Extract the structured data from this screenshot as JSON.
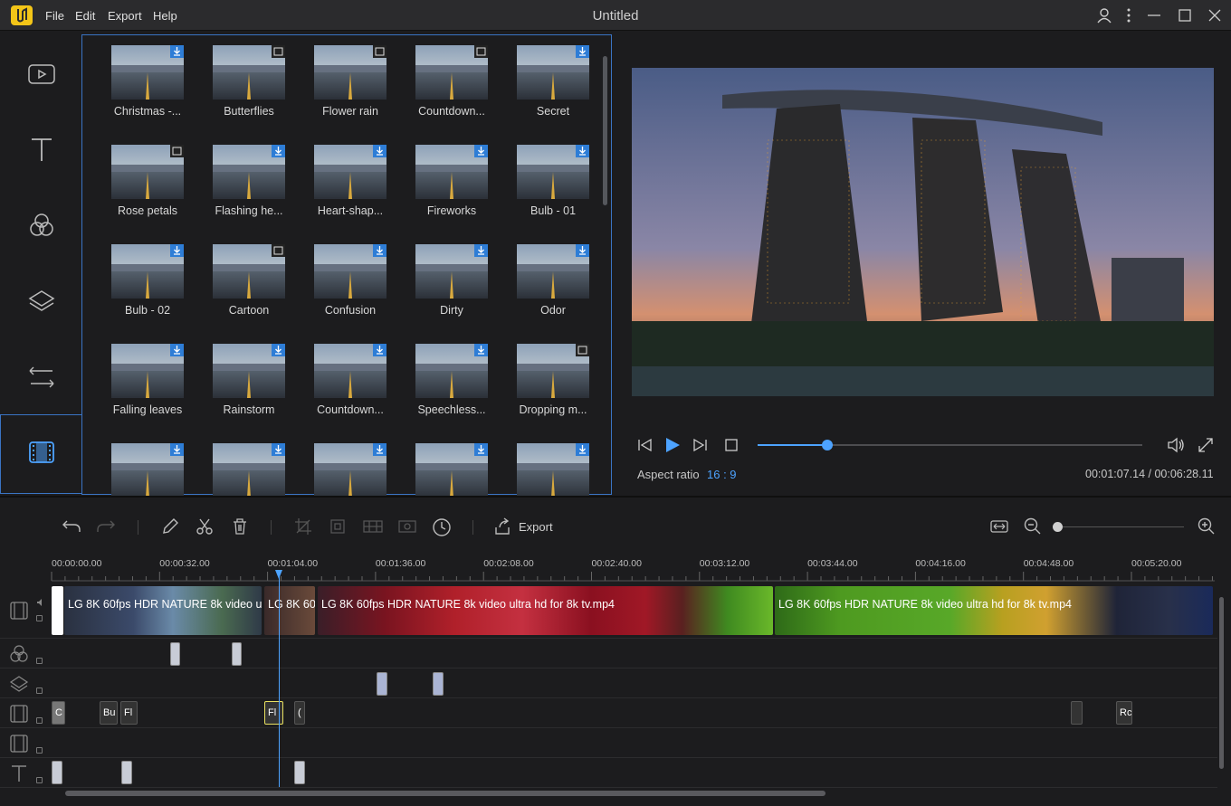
{
  "app": {
    "title": "Untitled",
    "menu": [
      "File",
      "Edit",
      "Export",
      "Help"
    ],
    "accent": "#3a74c4",
    "highlight": "#4da3ff"
  },
  "sidebar": {
    "items": [
      {
        "icon": "media-icon"
      },
      {
        "icon": "text-icon"
      },
      {
        "icon": "filters-icon"
      },
      {
        "icon": "overlays-icon"
      },
      {
        "icon": "transitions-icon"
      },
      {
        "icon": "effects-film-icon",
        "active": true
      }
    ]
  },
  "effects": [
    {
      "label": "Christmas -...",
      "badge": "download"
    },
    {
      "label": "Butterflies",
      "badge": "film"
    },
    {
      "label": "Flower rain",
      "badge": "film"
    },
    {
      "label": "Countdown...",
      "badge": "film"
    },
    {
      "label": "Secret",
      "badge": "download"
    },
    {
      "label": "Rose petals",
      "badge": "film"
    },
    {
      "label": "Flashing he...",
      "badge": "download"
    },
    {
      "label": "Heart-shap...",
      "badge": "download"
    },
    {
      "label": "Fireworks",
      "badge": "download"
    },
    {
      "label": "Bulb - 01",
      "badge": "download"
    },
    {
      "label": "Bulb - 02",
      "badge": "download"
    },
    {
      "label": "Cartoon",
      "badge": "film"
    },
    {
      "label": "Confusion",
      "badge": "download"
    },
    {
      "label": "Dirty",
      "badge": "download"
    },
    {
      "label": "Odor",
      "badge": "download"
    },
    {
      "label": "Falling leaves",
      "badge": "download"
    },
    {
      "label": "Rainstorm",
      "badge": "download"
    },
    {
      "label": "Countdown...",
      "badge": "download"
    },
    {
      "label": "Speechless...",
      "badge": "download"
    },
    {
      "label": "Dropping m...",
      "badge": "film"
    },
    {
      "label": "",
      "badge": "download"
    },
    {
      "label": "",
      "badge": "download"
    },
    {
      "label": "",
      "badge": "download"
    },
    {
      "label": "",
      "badge": "download"
    },
    {
      "label": "",
      "badge": "download"
    }
  ],
  "player": {
    "aspect_label": "Aspect ratio",
    "aspect_value": "16 : 9",
    "time": "00:01:07.14 / 00:06:28.11",
    "progress": 0.18
  },
  "toolbar": {
    "export_label": "Export",
    "zoom_level": 0.0
  },
  "timeline": {
    "ruler": [
      "00:00:00.00",
      "00:00:32.00",
      "00:01:04.00",
      "00:01:36.00",
      "00:02:08.00",
      "00:02:40.00",
      "00:03:12.00",
      "00:03:44.00",
      "00:04:16.00",
      "00:04:48.00",
      "00:05:20.00"
    ],
    "video_clips": [
      "LG 8K 60fps HDR NATURE 8k video u",
      "LG 8K 60",
      "LG 8K 60fps HDR NATURE 8k video ultra hd for 8k tv.mp4",
      "LG 8K 60fps HDR NATURE 8k video ultra hd for 8k tv.mp4"
    ],
    "effect_clips": [
      "C",
      "Bu",
      "Fl",
      "Fl",
      "(",
      "",
      "Rc"
    ]
  }
}
